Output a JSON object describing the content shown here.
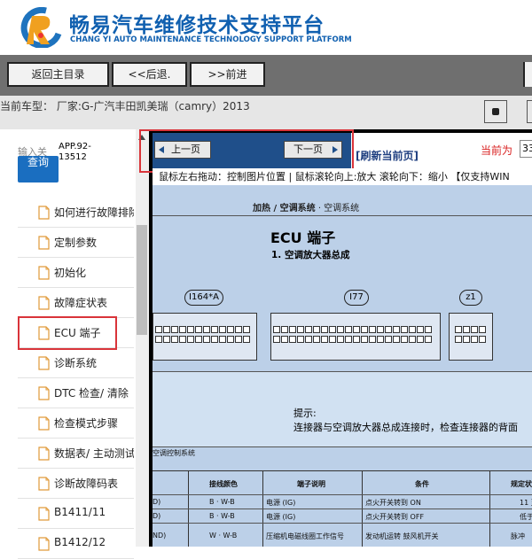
{
  "brand": {
    "title": "畅易汽车维修技术支持平台",
    "subtitle": "CHANG YI AUTO MAINTENANCE TECHNOLOGY SUPPORT PLATFORM",
    "color": "#1060b0"
  },
  "nav": {
    "home": "返回主目录",
    "back": "<<后退.",
    "forward": ">>前进"
  },
  "car_info": "当前车型： 厂家:G-广汽丰田凯美瑞（camry）2013",
  "sidebar": {
    "input_label": "输入关",
    "query_button": "查询",
    "code": "APP.92-13512",
    "items": [
      {
        "label": "如何进行故障排除"
      },
      {
        "label": "定制参数"
      },
      {
        "label": "初始化"
      },
      {
        "label": "故障症状表"
      },
      {
        "label": "ECU 端子"
      },
      {
        "label": "诊断系统"
      },
      {
        "label": "DTC 检查/ 清除"
      },
      {
        "label": "检查模式步骤"
      },
      {
        "label": "数据表/ 主动测试"
      },
      {
        "label": "诊断故障码表"
      },
      {
        "label": "B1411/11"
      },
      {
        "label": "B1412/12"
      }
    ]
  },
  "pager": {
    "prev": "上一页",
    "next": "下一页",
    "refresh": "[刷新当前页]",
    "current_label": "当前为",
    "current_value": "33"
  },
  "hint": "鼠标左右拖动：控制图片位置 | 鼠标滚轮向上:放大  滚轮向下：缩小 【仅支持WIN",
  "doc": {
    "section": "加热 / 空调系统",
    "section_sub": "· 空调系统",
    "title": "ECU 端子",
    "subtitle": "1.   空调放大器总成",
    "connectors": [
      "I164*A",
      "I77",
      "z1"
    ],
    "tip_title": "提示:",
    "tip_text": "连接器与空调放大器总成连接时，检查连接器的背面",
    "control_row": "空调控制系统",
    "table": {
      "headers": [
        "接线颜色",
        "端子说明",
        "条件",
        "规定状"
      ],
      "rows": [
        {
          "code": "D)",
          "color": "B · W-B",
          "desc": "电源 (IG)",
          "cond": "点火开关转到 ON",
          "spec": "11 至"
        },
        {
          "code": "D)",
          "color": "B · W-B",
          "desc": "电源 (IG)",
          "cond": "点火开关转到 OFF",
          "spec": "低于"
        },
        {
          "code": "ND)",
          "color": "W · W-B",
          "desc": "压缩机电磁线圈工作信号",
          "cond": "发动机运转 鼓风机开关",
          "spec": "脉冲"
        }
      ]
    }
  },
  "colors": {
    "navbar": "#6f6f6f",
    "query_button": "#1a6ec0",
    "highlight": "#d9343a",
    "pager_bar": "#1f4f8a",
    "doc_bg": "#bcd0e8"
  }
}
